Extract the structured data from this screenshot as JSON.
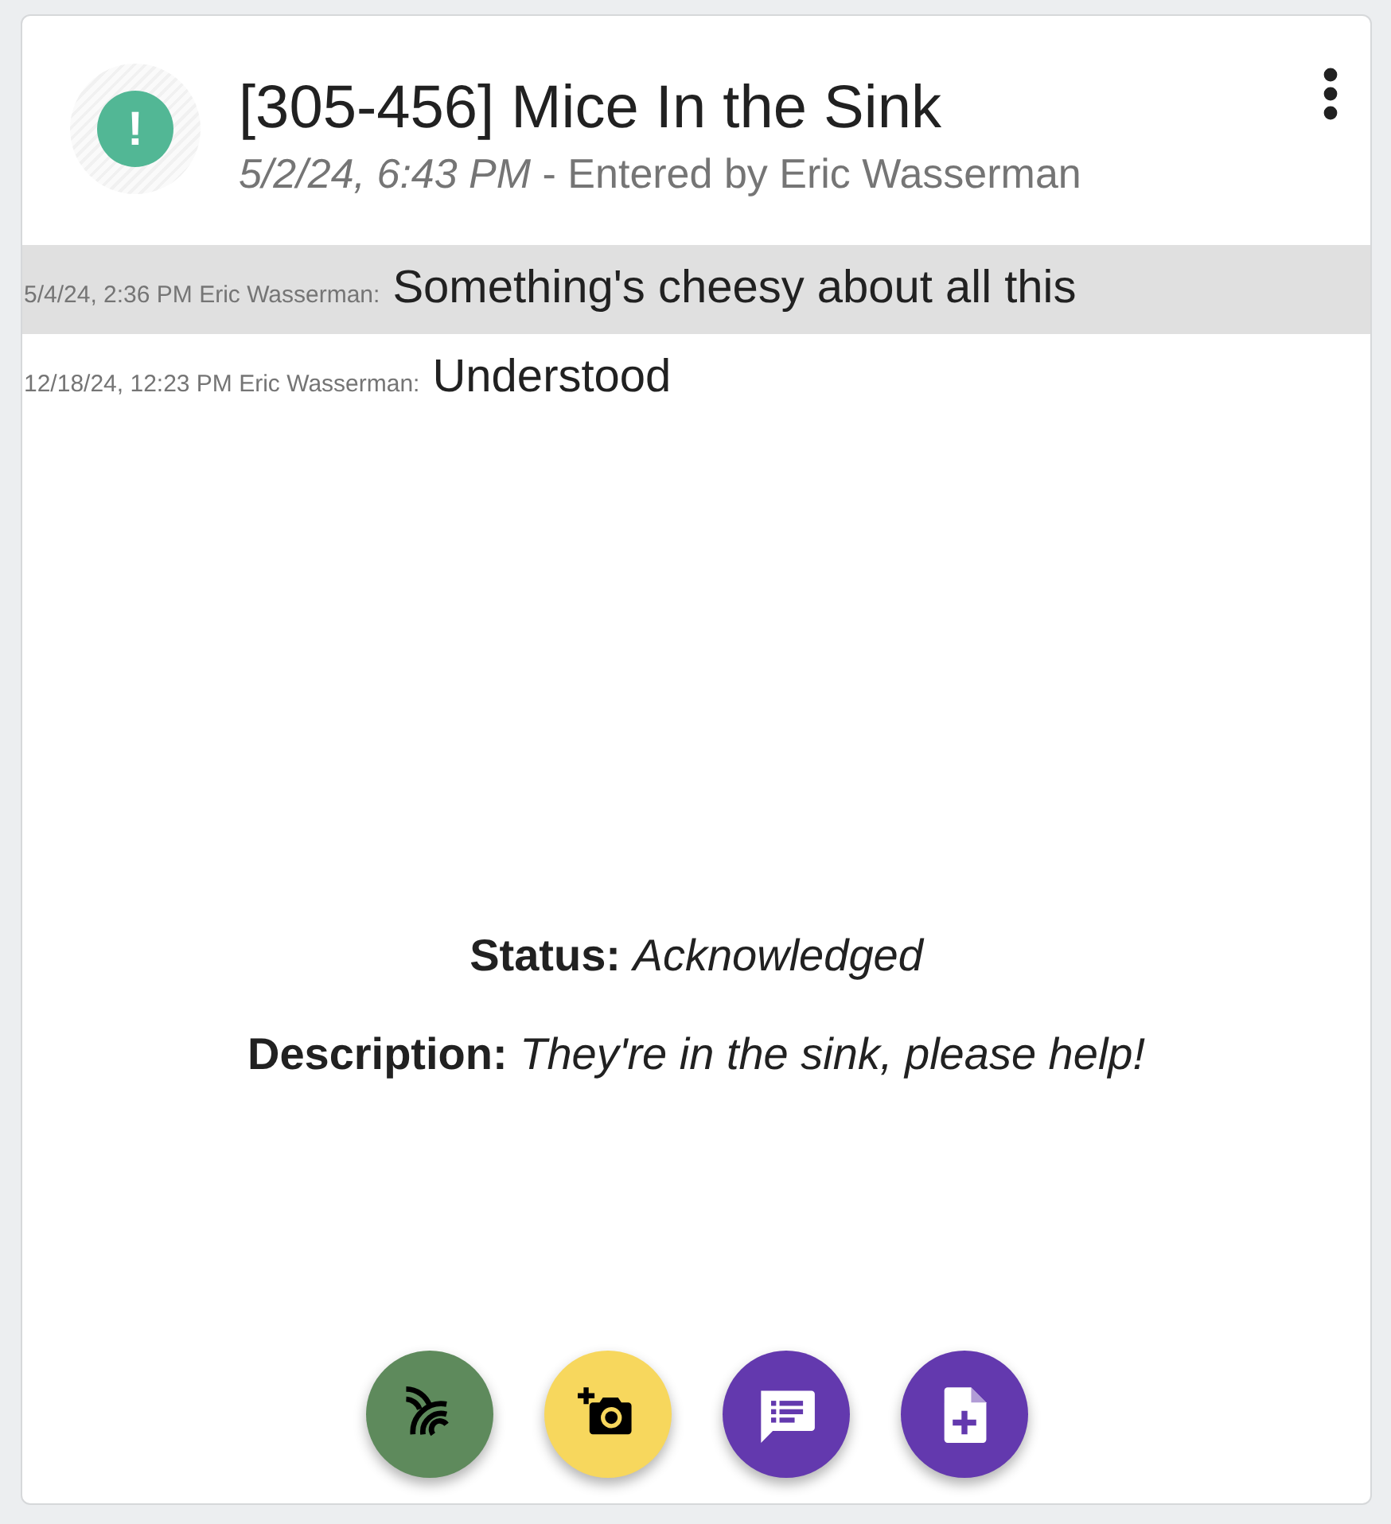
{
  "header": {
    "status_icon": {
      "symbol": "!",
      "color": "#52b795"
    },
    "title": "[305-456] Mice In the Sink",
    "timestamp": "5/2/24, 6:43 PM",
    "entered_by": " - Entered by Eric Wasserman"
  },
  "messages": [
    {
      "meta": "5/4/24, 2:36 PM Eric Wasserman:",
      "text": "Something's cheesy about all this",
      "highlighted": true
    },
    {
      "meta": "12/18/24, 12:23 PM Eric Wasserman:",
      "text": "Understood",
      "highlighted": false
    }
  ],
  "details": [
    {
      "label": "Status:",
      "value": "Acknowledged"
    },
    {
      "label": "Description:",
      "value": "They're in the sink, please help!"
    }
  ],
  "actions": [
    {
      "kind": "signal",
      "color": "#5e8a5c"
    },
    {
      "kind": "camera",
      "color": "#f7d75d"
    },
    {
      "kind": "comment",
      "color": "#6339ae"
    },
    {
      "kind": "file",
      "color": "#6339ae"
    }
  ]
}
